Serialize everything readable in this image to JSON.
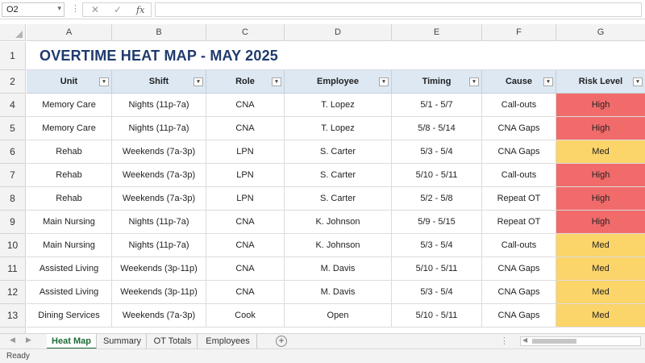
{
  "formula_bar": {
    "name_box": "O2",
    "cancel_icon": "✕",
    "enter_icon": "✓",
    "fx_label": "fx"
  },
  "columns": [
    "A",
    "B",
    "C",
    "D",
    "E",
    "F",
    "G"
  ],
  "row_numbers": [
    "1",
    "2",
    "4",
    "5",
    "6",
    "7",
    "8",
    "9",
    "10",
    "11",
    "12",
    "13"
  ],
  "title": "OVERTIME HEAT MAP - MAY 2025",
  "headers": [
    "Unit",
    "Shift",
    "Role",
    "Employee",
    "Timing",
    "Cause",
    "Risk Level"
  ],
  "rows": [
    [
      "Memory Care",
      "Nights (11p-7a)",
      "CNA",
      "T. Lopez",
      "5/1 - 5/7",
      "Call-outs",
      "High"
    ],
    [
      "Memory Care",
      "Nights (11p-7a)",
      "CNA",
      "T. Lopez",
      "5/8 - 5/14",
      "CNA Gaps",
      "High"
    ],
    [
      "Rehab",
      "Weekends (7a-3p)",
      "LPN",
      "S. Carter",
      "5/3 - 5/4",
      "CNA Gaps",
      "Med"
    ],
    [
      "Rehab",
      "Weekends (7a-3p)",
      "LPN",
      "S. Carter",
      "5/10 - 5/11",
      "Call-outs",
      "High"
    ],
    [
      "Rehab",
      "Weekends (7a-3p)",
      "LPN",
      "S. Carter",
      "5/2 - 5/8",
      "Repeat OT",
      "High"
    ],
    [
      "Main Nursing",
      "Nights (11p-7a)",
      "CNA",
      "K. Johnson",
      "5/9 - 5/15",
      "Repeat OT",
      "High"
    ],
    [
      "Main Nursing",
      "Nights (11p-7a)",
      "CNA",
      "K. Johnson",
      "5/3 - 5/4",
      "Call-outs",
      "Med"
    ],
    [
      "Assisted Living",
      "Weekends (3p-11p)",
      "CNA",
      "M. Davis",
      "5/10 - 5/11",
      "CNA Gaps",
      "Med"
    ],
    [
      "Assisted Living",
      "Weekends (3p-11p)",
      "CNA",
      "M. Davis",
      "5/3 - 5/4",
      "CNA Gaps",
      "Med"
    ],
    [
      "Dining Services",
      "Weekends (7a-3p)",
      "Cook",
      "Open",
      "5/10 - 5/11",
      "CNA Gaps",
      "Med"
    ]
  ],
  "risk_colors": {
    "High": "#f16b6b",
    "Med": "#fbd46a"
  },
  "sheet_tabs": [
    {
      "label": "Heat Map",
      "active": true
    },
    {
      "label": "Summary",
      "active": false
    },
    {
      "label": "OT Totals",
      "active": false
    },
    {
      "label": "Employees",
      "active": false
    }
  ],
  "status": "Ready"
}
